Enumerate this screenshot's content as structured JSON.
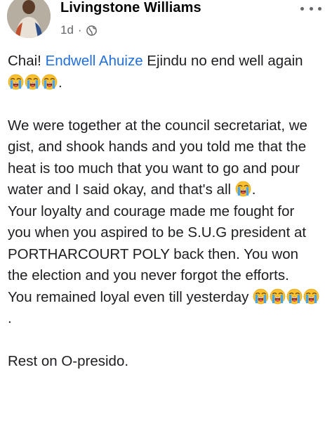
{
  "post": {
    "author": "Livingstone Williams",
    "age": "1d",
    "separator": "·",
    "privacy_icon": "globe-icon",
    "more_icon": "more-options-icon",
    "paragraph1": {
      "lead": "Chai! ",
      "mention": "Endwell Ahuize",
      "rest": " Ejindu no end well again ",
      "emoji_count": 3,
      "end": "."
    },
    "paragraph2": {
      "text": "We were together at the council secretariat, we gist, and shook hands and you told me that the heat is too much that you want to go and pour water and I said okay, and that's all ",
      "emoji_count": 1,
      "end": "."
    },
    "paragraph3": {
      "text": "Your loyalty and courage made me fought for you when you aspired to be S.U.G president at PORTHARCOURT POLY back then. You won the election and you never forgot the efforts."
    },
    "paragraph4": {
      "text": "You remained loyal even till yesterday ",
      "emoji_count": 4,
      "end": "."
    },
    "paragraph5": {
      "text": "Rest on O-presido."
    },
    "emoji_name": "loudly-crying-face-icon",
    "colors": {
      "author": "#050505",
      "meta": "#65676b",
      "mention": "#216fdb",
      "text": "#1c1e21"
    }
  }
}
